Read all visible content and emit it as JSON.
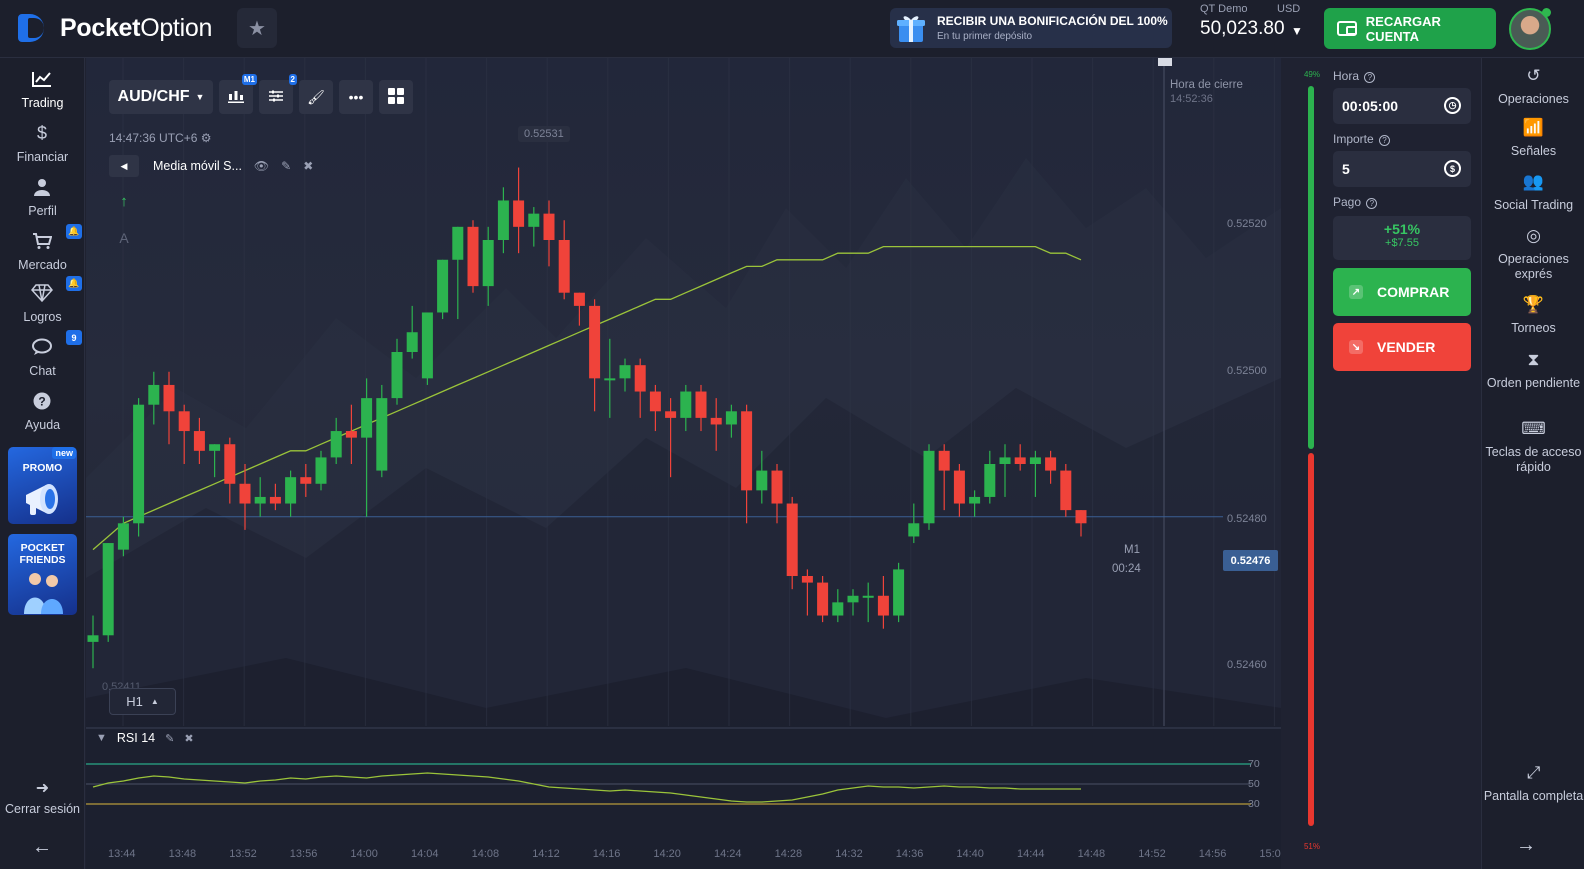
{
  "brand": {
    "name_bold": "Pocket",
    "name_light": "Option"
  },
  "promo_banner": {
    "title": "RECIBIR UNA BONIFICACIÓN DEL 100%",
    "subtitle": "En tu primer depósito"
  },
  "account": {
    "type": "QT Demo",
    "currency": "USD",
    "balance": "50,023.80"
  },
  "deposit_button": "RECARGAR CUENTA",
  "left_nav": {
    "items": [
      {
        "label": "Trading",
        "icon": "chart-line-icon",
        "badge": ""
      },
      {
        "label": "Financiar",
        "icon": "dollar-icon",
        "badge": ""
      },
      {
        "label": "Perfil",
        "icon": "user-icon",
        "badge": ""
      },
      {
        "label": "Mercado",
        "icon": "cart-icon",
        "badge": "🔔"
      },
      {
        "label": "Logros",
        "icon": "diamond-icon",
        "badge": "🔔"
      },
      {
        "label": "Chat",
        "icon": "chat-icon",
        "badge": "9"
      },
      {
        "label": "Ayuda",
        "icon": "help-icon",
        "badge": ""
      }
    ],
    "promo_label": "PROMO",
    "promo_new": "new",
    "friends_label": "POCKET FRIENDS",
    "logout": "Cerrar sesión"
  },
  "chart_toolbar": {
    "pair": "AUD/CHF",
    "timeframe_badge": "M1",
    "indicators_badge": "2",
    "clock": "14:47:36 UTC+6",
    "indicator_name": "Media móvil S...",
    "timeframe_selector": "H1",
    "tf_ghost": "0.52411"
  },
  "chart_labels": {
    "top_price_tag": "0.52531",
    "close_time_label": "Hora de cierre",
    "close_time": "14:52:36",
    "current_price": "0.52476",
    "candle_tf": "M1",
    "candle_timer": "00:24",
    "price_axis": [
      "0.52520",
      "0.52500",
      "0.52480",
      "0.52460"
    ],
    "rsi_name": "RSI 14",
    "rsi_levels": [
      "70",
      "50",
      "30"
    ],
    "time_axis": [
      "13:44",
      "13:48",
      "13:52",
      "13:56",
      "14:00",
      "14:04",
      "14:08",
      "14:12",
      "14:16",
      "14:20",
      "14:24",
      "14:28",
      "14:32",
      "14:36",
      "14:40",
      "14:44",
      "14:48",
      "14:52",
      "14:56",
      "15:0"
    ]
  },
  "sentiment": {
    "up": "49%",
    "down": "51%",
    "up_fraction": 0.49,
    "colors": {
      "up": "#2cb34f",
      "down": "#e8372f"
    }
  },
  "trade_panel": {
    "time_label": "Hora",
    "time_value": "00:05:00",
    "amount_label": "Importe",
    "amount_value": "5",
    "payout_label": "Pago",
    "payout_pct": "+51%",
    "payout_amount": "+$7.55",
    "buy_label": "COMPRAR",
    "sell_label": "VENDER"
  },
  "right_nav": [
    {
      "label": "Operaciones",
      "icon": "history-icon"
    },
    {
      "label": "Señales",
      "icon": "signal-icon"
    },
    {
      "label": "Social Trading",
      "icon": "users-icon"
    },
    {
      "label": "Operaciones exprés",
      "icon": "target-icon"
    },
    {
      "label": "Torneos",
      "icon": "trophy-icon"
    },
    {
      "label": "Orden pendiente",
      "icon": "hourglass-icon"
    },
    {
      "label": "Teclas de acceso rápido",
      "icon": "keyboard-icon"
    },
    {
      "label": "Pantalla completa",
      "icon": "fullscreen-icon"
    }
  ],
  "chart_data": {
    "type": "candlestick",
    "symbol": "AUD/CHF",
    "x_ticks": [
      "13:44",
      "13:48",
      "13:52",
      "13:56",
      "14:00",
      "14:04",
      "14:08",
      "14:12",
      "14:16",
      "14:20",
      "14:24",
      "14:28",
      "14:32",
      "14:36",
      "14:40",
      "14:44",
      "14:48",
      "14:52",
      "14:56"
    ],
    "ylim": [
      0.5245,
      0.52535
    ],
    "y_ticks": [
      0.5246,
      0.5248,
      0.525,
      0.5252
    ],
    "candles": [
      {
        "o": 0.52457,
        "h": 0.52461,
        "l": 0.52453,
        "c": 0.52458
      },
      {
        "o": 0.52458,
        "h": 0.52472,
        "l": 0.52457,
        "c": 0.52472
      },
      {
        "o": 0.52471,
        "h": 0.52476,
        "l": 0.5247,
        "c": 0.52475
      },
      {
        "o": 0.52475,
        "h": 0.52494,
        "l": 0.52473,
        "c": 0.52493
      },
      {
        "o": 0.52493,
        "h": 0.52498,
        "l": 0.5249,
        "c": 0.52496
      },
      {
        "o": 0.52496,
        "h": 0.52498,
        "l": 0.52487,
        "c": 0.52492
      },
      {
        "o": 0.52492,
        "h": 0.52493,
        "l": 0.52484,
        "c": 0.52489
      },
      {
        "o": 0.52489,
        "h": 0.52491,
        "l": 0.52484,
        "c": 0.52486
      },
      {
        "o": 0.52486,
        "h": 0.52487,
        "l": 0.52482,
        "c": 0.52487
      },
      {
        "o": 0.52487,
        "h": 0.52488,
        "l": 0.52478,
        "c": 0.52481
      },
      {
        "o": 0.52481,
        "h": 0.52484,
        "l": 0.52474,
        "c": 0.52478
      },
      {
        "o": 0.52478,
        "h": 0.52482,
        "l": 0.52476,
        "c": 0.52479
      },
      {
        "o": 0.52479,
        "h": 0.52481,
        "l": 0.52477,
        "c": 0.52478
      },
      {
        "o": 0.52478,
        "h": 0.52483,
        "l": 0.52476,
        "c": 0.52482
      },
      {
        "o": 0.52482,
        "h": 0.52484,
        "l": 0.52479,
        "c": 0.52481
      },
      {
        "o": 0.52481,
        "h": 0.52486,
        "l": 0.5248,
        "c": 0.52485
      },
      {
        "o": 0.52485,
        "h": 0.52491,
        "l": 0.52484,
        "c": 0.52489
      },
      {
        "o": 0.52489,
        "h": 0.52493,
        "l": 0.52484,
        "c": 0.52488
      },
      {
        "o": 0.52488,
        "h": 0.52497,
        "l": 0.52476,
        "c": 0.52494
      },
      {
        "o": 0.52483,
        "h": 0.52496,
        "l": 0.52482,
        "c": 0.52494
      },
      {
        "o": 0.52494,
        "h": 0.52503,
        "l": 0.52493,
        "c": 0.52501
      },
      {
        "o": 0.52501,
        "h": 0.52508,
        "l": 0.525,
        "c": 0.52504
      },
      {
        "o": 0.52497,
        "h": 0.52507,
        "l": 0.52496,
        "c": 0.52507
      },
      {
        "o": 0.52507,
        "h": 0.52515,
        "l": 0.52506,
        "c": 0.52515
      },
      {
        "o": 0.52515,
        "h": 0.5252,
        "l": 0.52506,
        "c": 0.5252
      },
      {
        "o": 0.5252,
        "h": 0.52521,
        "l": 0.5251,
        "c": 0.52511
      },
      {
        "o": 0.52511,
        "h": 0.5252,
        "l": 0.52508,
        "c": 0.52518
      },
      {
        "o": 0.52518,
        "h": 0.52526,
        "l": 0.52516,
        "c": 0.52524
      },
      {
        "o": 0.52524,
        "h": 0.52529,
        "l": 0.52516,
        "c": 0.5252
      },
      {
        "o": 0.5252,
        "h": 0.52523,
        "l": 0.52517,
        "c": 0.52522
      },
      {
        "o": 0.52522,
        "h": 0.52524,
        "l": 0.52514,
        "c": 0.52518
      },
      {
        "o": 0.52518,
        "h": 0.52521,
        "l": 0.52509,
        "c": 0.5251
      },
      {
        "o": 0.5251,
        "h": 0.5251,
        "l": 0.52505,
        "c": 0.52508
      },
      {
        "o": 0.52508,
        "h": 0.52509,
        "l": 0.52492,
        "c": 0.52497
      },
      {
        "o": 0.52497,
        "h": 0.52503,
        "l": 0.52491,
        "c": 0.52497
      },
      {
        "o": 0.52497,
        "h": 0.525,
        "l": 0.52495,
        "c": 0.52499
      },
      {
        "o": 0.52499,
        "h": 0.525,
        "l": 0.52491,
        "c": 0.52495
      },
      {
        "o": 0.52495,
        "h": 0.52496,
        "l": 0.52489,
        "c": 0.52492
      },
      {
        "o": 0.52492,
        "h": 0.52494,
        "l": 0.52482,
        "c": 0.52491
      },
      {
        "o": 0.52491,
        "h": 0.52496,
        "l": 0.52489,
        "c": 0.52495
      },
      {
        "o": 0.52495,
        "h": 0.52496,
        "l": 0.52489,
        "c": 0.52491
      },
      {
        "o": 0.52491,
        "h": 0.52494,
        "l": 0.52486,
        "c": 0.5249
      },
      {
        "o": 0.5249,
        "h": 0.52493,
        "l": 0.52488,
        "c": 0.52492
      },
      {
        "o": 0.52492,
        "h": 0.52493,
        "l": 0.52475,
        "c": 0.5248
      },
      {
        "o": 0.5248,
        "h": 0.52486,
        "l": 0.52478,
        "c": 0.52483
      },
      {
        "o": 0.52483,
        "h": 0.52484,
        "l": 0.52475,
        "c": 0.52478
      },
      {
        "o": 0.52478,
        "h": 0.52479,
        "l": 0.52465,
        "c": 0.52467
      },
      {
        "o": 0.52467,
        "h": 0.52468,
        "l": 0.52461,
        "c": 0.52466
      },
      {
        "o": 0.52466,
        "h": 0.52467,
        "l": 0.5246,
        "c": 0.52461
      },
      {
        "o": 0.52461,
        "h": 0.52465,
        "l": 0.5246,
        "c": 0.52463
      },
      {
        "o": 0.52463,
        "h": 0.52465,
        "l": 0.52461,
        "c": 0.52464
      },
      {
        "o": 0.52464,
        "h": 0.52466,
        "l": 0.5246,
        "c": 0.52464
      },
      {
        "o": 0.52464,
        "h": 0.52467,
        "l": 0.52459,
        "c": 0.52461
      },
      {
        "o": 0.52461,
        "h": 0.52469,
        "l": 0.5246,
        "c": 0.52468
      },
      {
        "o": 0.52473,
        "h": 0.52478,
        "l": 0.52472,
        "c": 0.52475
      },
      {
        "o": 0.52475,
        "h": 0.52487,
        "l": 0.52474,
        "c": 0.52486
      },
      {
        "o": 0.52486,
        "h": 0.52487,
        "l": 0.52477,
        "c": 0.52483
      },
      {
        "o": 0.52483,
        "h": 0.52484,
        "l": 0.52476,
        "c": 0.52478
      },
      {
        "o": 0.52478,
        "h": 0.5248,
        "l": 0.52476,
        "c": 0.52479
      },
      {
        "o": 0.52479,
        "h": 0.52486,
        "l": 0.52478,
        "c": 0.52484
      },
      {
        "o": 0.52484,
        "h": 0.52487,
        "l": 0.52479,
        "c": 0.52485
      },
      {
        "o": 0.52485,
        "h": 0.52487,
        "l": 0.52483,
        "c": 0.52484
      },
      {
        "o": 0.52484,
        "h": 0.52486,
        "l": 0.52479,
        "c": 0.52485
      },
      {
        "o": 0.52485,
        "h": 0.52486,
        "l": 0.52481,
        "c": 0.52483
      },
      {
        "o": 0.52483,
        "h": 0.52484,
        "l": 0.52476,
        "c": 0.52477
      },
      {
        "o": 0.52477,
        "h": 0.52477,
        "l": 0.52473,
        "c": 0.52475
      }
    ],
    "moving_average": [
      0.52471,
      0.52473,
      0.52475,
      0.52476,
      0.52477,
      0.52478,
      0.52479,
      0.5248,
      0.52481,
      0.52482,
      0.52483,
      0.52484,
      0.52485,
      0.52486,
      0.52486,
      0.52487,
      0.52488,
      0.52489,
      0.5249,
      0.52491,
      0.52492,
      0.52493,
      0.52494,
      0.52495,
      0.52496,
      0.52497,
      0.52498,
      0.52499,
      0.525,
      0.52501,
      0.52502,
      0.52503,
      0.52504,
      0.52505,
      0.52506,
      0.52507,
      0.52508,
      0.52509,
      0.52509,
      0.5251,
      0.52511,
      0.52512,
      0.52513,
      0.52514,
      0.52514,
      0.52515,
      0.52515,
      0.52515,
      0.52515,
      0.52516,
      0.52516,
      0.52516,
      0.52517,
      0.52517,
      0.52517,
      0.52517,
      0.52517,
      0.52517,
      0.52517,
      0.52517,
      0.52517,
      0.52517,
      0.52517,
      0.52516,
      0.52516,
      0.52515
    ],
    "rsi": [
      47,
      51,
      53,
      56,
      58,
      57,
      55,
      54,
      53,
      52,
      51,
      53,
      54,
      56,
      55,
      57,
      58,
      57,
      56,
      58,
      59,
      60,
      61,
      60,
      59,
      58,
      57,
      55,
      53,
      50,
      47,
      46,
      45,
      44,
      43,
      44,
      43,
      42,
      41,
      39,
      37,
      35,
      33,
      32,
      32,
      33,
      34,
      37,
      40,
      44,
      46,
      48,
      47,
      47,
      46,
      47,
      48,
      47,
      47,
      46,
      46,
      45,
      45,
      45,
      45,
      45
    ]
  }
}
